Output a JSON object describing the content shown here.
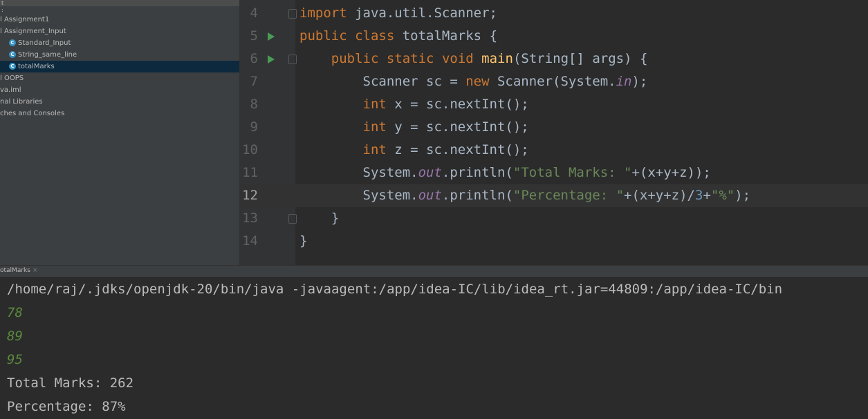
{
  "project_panel": {
    "header_text": "t",
    "header_sub": ":",
    "items": [
      {
        "label": "l Assignment1",
        "has_icon": false,
        "selected": false,
        "indent": 0
      },
      {
        "label": "l Assignment_Input",
        "has_icon": false,
        "selected": false,
        "indent": 0
      },
      {
        "label": "Standard_Input",
        "has_icon": true,
        "selected": false,
        "indent": 13
      },
      {
        "label": "String_same_line",
        "has_icon": true,
        "selected": false,
        "indent": 13
      },
      {
        "label": "totalMarks",
        "has_icon": true,
        "selected": true,
        "indent": 13
      },
      {
        "label": "l OOPS",
        "has_icon": false,
        "selected": false,
        "indent": 0
      },
      {
        "label": "va.iml",
        "has_icon": false,
        "selected": false,
        "indent": 0
      },
      {
        "label": "nal Libraries",
        "has_icon": false,
        "selected": false,
        "indent": 0
      },
      {
        "label": "ches and Consoles",
        "has_icon": false,
        "selected": false,
        "indent": 0
      }
    ]
  },
  "editor": {
    "current_line": "12",
    "lines": [
      {
        "num": "4",
        "code": "import java.util.Scanner;"
      },
      {
        "num": "5",
        "code": "public class totalMarks {"
      },
      {
        "num": "6",
        "code": "    public static void main(String[] args) {"
      },
      {
        "num": "7",
        "code": "        Scanner sc = new Scanner(System.in);"
      },
      {
        "num": "8",
        "code": "        int x = sc.nextInt();"
      },
      {
        "num": "9",
        "code": "        int y = sc.nextInt();"
      },
      {
        "num": "10",
        "code": "        int z = sc.nextInt();"
      },
      {
        "num": "11",
        "code": "        System.out.println(\"Total Marks: \"+(x+y+z));"
      },
      {
        "num": "12",
        "code": "        System.out.println(\"Percentage: \"+(x+y+z)/3+\"%\");"
      },
      {
        "num": "13",
        "code": "    }"
      },
      {
        "num": "14",
        "code": "}"
      }
    ]
  },
  "run_tab": {
    "label": "otalMarks",
    "close": "×"
  },
  "console": {
    "command": "/home/raj/.jdks/openjdk-20/bin/java -javaagent:/app/idea-IC/lib/idea_rt.jar=44809:/app/idea-IC/bin",
    "inputs": [
      "78",
      "89",
      "95"
    ],
    "outputs": [
      "Total Marks: 262",
      "Percentage: 87%"
    ]
  },
  "colors": {
    "keyword": "#cc7832",
    "method": "#ffc66d",
    "static_field": "#9876aa",
    "string": "#6a8759",
    "number": "#6897bb",
    "run_arrow": "#499c54",
    "console_input": "#5a8a3c",
    "selection": "#0d293e"
  }
}
